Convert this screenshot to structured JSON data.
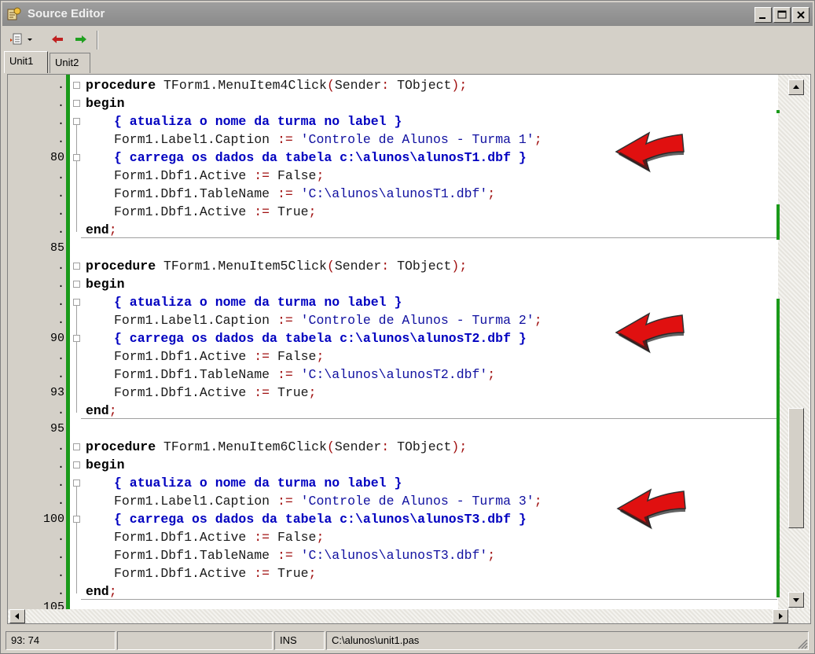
{
  "window": {
    "title": "Source Editor"
  },
  "tabs": [
    {
      "label": "Unit1",
      "active": true
    },
    {
      "label": "Unit2",
      "active": false
    }
  ],
  "gutter": {
    "line_numbers": [
      ".",
      ".",
      ".",
      ".",
      "80",
      ".",
      ".",
      ".",
      ".",
      "85",
      ".",
      ".",
      ".",
      ".",
      "90",
      ".",
      ".",
      "93",
      ".",
      "95",
      ".",
      ".",
      ".",
      ".",
      "100",
      ".",
      ".",
      ".",
      ".",
      "105"
    ]
  },
  "code": {
    "procs": [
      {
        "header": {
          "kw": "procedure",
          "name": " TForm1.MenuItem4Click",
          "p1": "(",
          "arg": "Sender",
          "p2": ": ",
          "type": "TObject",
          "p3": ");"
        },
        "begin": "begin",
        "comment1": "{ atualiza o nome da turma no label }",
        "caption_left": "Form1.Label1.Caption",
        "caption_op": " := ",
        "caption_str": "'Controle de Alunos - Turma 1'",
        "caption_end": ";",
        "comment2": "{ carrega os dados da tabela c:\\alunos\\alunosT1.dbf }",
        "a1_left": "Form1.Dbf1.Active",
        "a1_op": " := ",
        "a1_val": "False",
        "a1_end": ";",
        "tn_left": "Form1.Dbf1.TableName",
        "tn_op": " := ",
        "tn_str": "'C:\\alunos\\alunosT1.dbf'",
        "tn_end": ";",
        "a2_left": "Form1.Dbf1.Active",
        "a2_op": " := ",
        "a2_val": "True",
        "a2_end": ";",
        "end": "end",
        "end_semi": ";"
      },
      {
        "header": {
          "kw": "procedure",
          "name": " TForm1.MenuItem5Click",
          "p1": "(",
          "arg": "Sender",
          "p2": ": ",
          "type": "TObject",
          "p3": ");"
        },
        "begin": "begin",
        "comment1": "{ atualiza o nome da turma no label }",
        "caption_left": "Form1.Label1.Caption",
        "caption_op": " := ",
        "caption_str": "'Controle de Alunos - Turma 2'",
        "caption_end": ";",
        "comment2": "{ carrega os dados da tabela c:\\alunos\\alunosT2.dbf }",
        "a1_left": "Form1.Dbf1.Active",
        "a1_op": " := ",
        "a1_val": "False",
        "a1_end": ";",
        "tn_left": "Form1.Dbf1.TableName",
        "tn_op": " := ",
        "tn_str": "'C:\\alunos\\alunosT2.dbf'",
        "tn_end": ";",
        "a2_left": "Form1.Dbf1.Active",
        "a2_op": " := ",
        "a2_val": "True",
        "a2_end": ";",
        "end": "end",
        "end_semi": ";"
      },
      {
        "header": {
          "kw": "procedure",
          "name": " TForm1.MenuItem6Click",
          "p1": "(",
          "arg": "Sender",
          "p2": ": ",
          "type": "TObject",
          "p3": ");"
        },
        "begin": "begin",
        "comment1": "{ atualiza o nome da turma no label }",
        "caption_left": "Form1.Label1.Caption",
        "caption_op": " := ",
        "caption_str": "'Controle de Alunos - Turma 3'",
        "caption_end": ";",
        "comment2": "{ carrega os dados da tabela c:\\alunos\\alunosT3.dbf }",
        "a1_left": "Form1.Dbf1.Active",
        "a1_op": " := ",
        "a1_val": "False",
        "a1_end": ";",
        "tn_left": "Form1.Dbf1.TableName",
        "tn_op": " := ",
        "tn_str": "'C:\\alunos\\alunosT3.dbf'",
        "tn_end": ";",
        "a2_left": "Form1.Dbf1.Active",
        "a2_op": " := ",
        "a2_val": "True",
        "a2_end": ";",
        "end": "end",
        "end_semi": ";"
      }
    ]
  },
  "status": {
    "position": "93: 74",
    "mode": "INS",
    "file": "C:\\alunos\\unit1.pas"
  },
  "colors": {
    "accent_green": "#1a9a1a",
    "arrow_red": "#e01010"
  }
}
